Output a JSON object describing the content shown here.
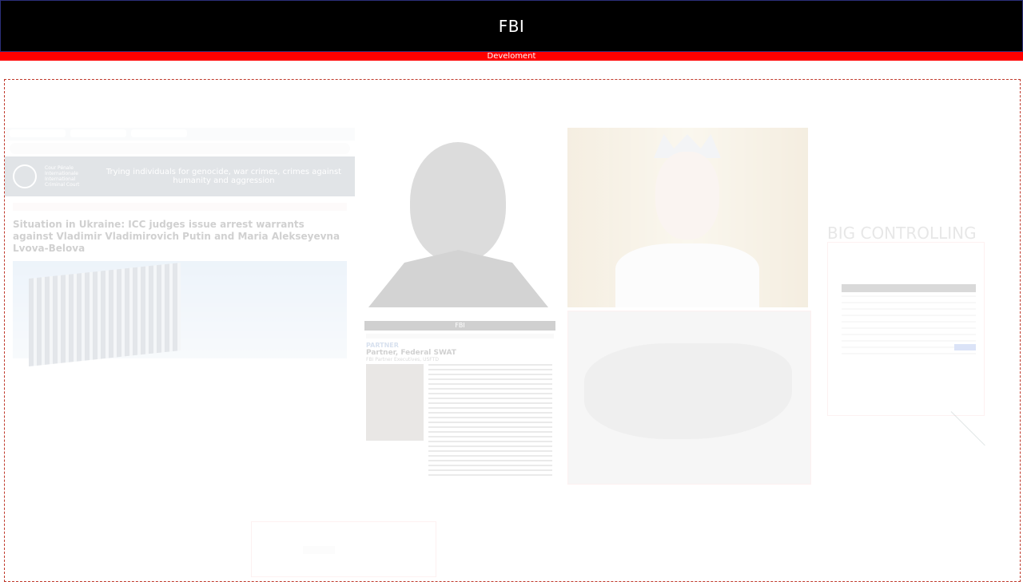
{
  "header": {
    "title": "FBI"
  },
  "dev_bar": {
    "label": "Develoment"
  },
  "icc_card": {
    "tagline": "Trying individuals for genocide, war crimes, crimes against humanity and aggression",
    "logo_text": "Cour Pénale Internationale International Criminal Court",
    "headline": "Situation in Ukraine: ICC judges issue arrest warrants against Vladimir Vladimirovich Putin and Maria Alekseyevna Lvova-Belova"
  },
  "fbi_card": {
    "bar_title": "FBI",
    "kicker": "PARTNER",
    "name": "Partner, Federal SWAT",
    "subtitle": "FBI Partner Executives, USFTD"
  },
  "right_section": {
    "title": "BIG CONTROLLING"
  },
  "colors": {
    "header_bg": "#000000",
    "dev_bar_bg": "#ff0000",
    "canvas_border": "#c0392b"
  }
}
